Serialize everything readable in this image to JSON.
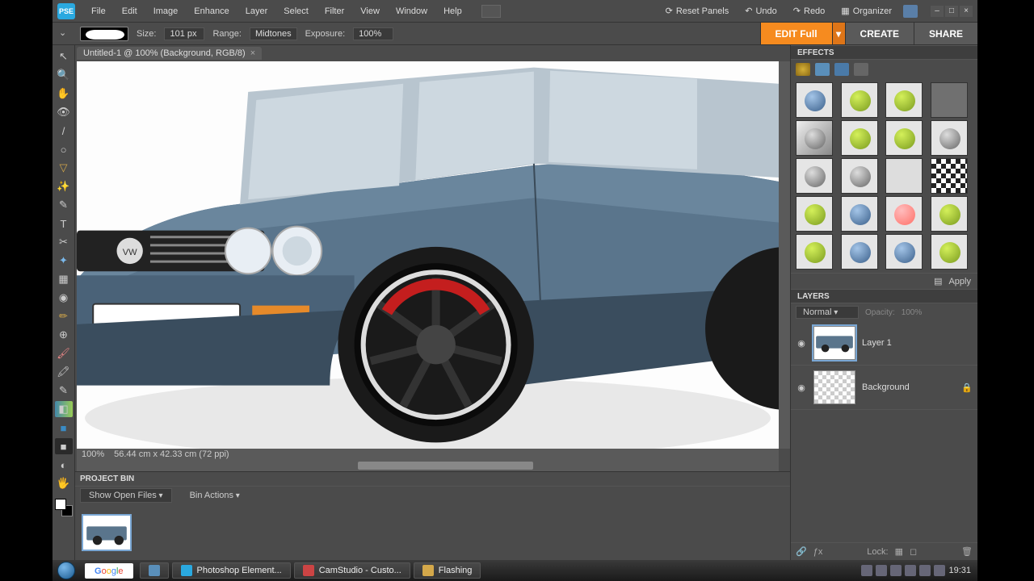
{
  "app": {
    "logo_text": "PSE"
  },
  "menubar": {
    "items": [
      "File",
      "Edit",
      "Image",
      "Enhance",
      "Layer",
      "Select",
      "Filter",
      "View",
      "Window",
      "Help"
    ],
    "reset": "Reset Panels",
    "undo": "Undo",
    "redo": "Redo",
    "organizer": "Organizer"
  },
  "options": {
    "size_label": "Size:",
    "size_value": "101 px",
    "range_label": "Range:",
    "range_value": "Midtones",
    "exposure_label": "Exposure:",
    "exposure_value": "100%"
  },
  "modes": {
    "edit": "EDIT Full",
    "create": "CREATE",
    "share": "SHARE"
  },
  "doc_tab": {
    "title": "Untitled-1 @ 100% (Background, RGB/8)",
    "close": "×"
  },
  "status": {
    "zoom": "100%",
    "dims": "56.44 cm x 42.33 cm (72 ppi)"
  },
  "project_bin": {
    "title": "PROJECT BIN",
    "show_open": "Show Open Files",
    "bin_actions": "Bin Actions"
  },
  "effects": {
    "title": "EFFECTS",
    "apply": "Apply"
  },
  "layers": {
    "title": "LAYERS",
    "blend": "Normal",
    "opacity_label": "Opacity:",
    "opacity_value": "100%",
    "items": [
      {
        "name": "Layer 1",
        "locked": false
      },
      {
        "name": "Background",
        "locked": true
      }
    ],
    "lock_label": "Lock:"
  },
  "taskbar": {
    "google": "Google",
    "items": [
      "",
      "Photoshop Element...",
      "CamStudio - Custo...",
      "Flashing"
    ],
    "time": "19:31"
  },
  "tool_icons": [
    "↖",
    "🔍",
    "✋",
    "👁",
    "/",
    "○",
    "▽",
    "✨",
    "✎",
    "T",
    "✂",
    "✦",
    "▦",
    "◉",
    "✏",
    "⊕",
    "🖌",
    "🖍",
    "✎",
    "◧",
    "■",
    "■",
    "◐",
    "🖐",
    "⬚"
  ]
}
